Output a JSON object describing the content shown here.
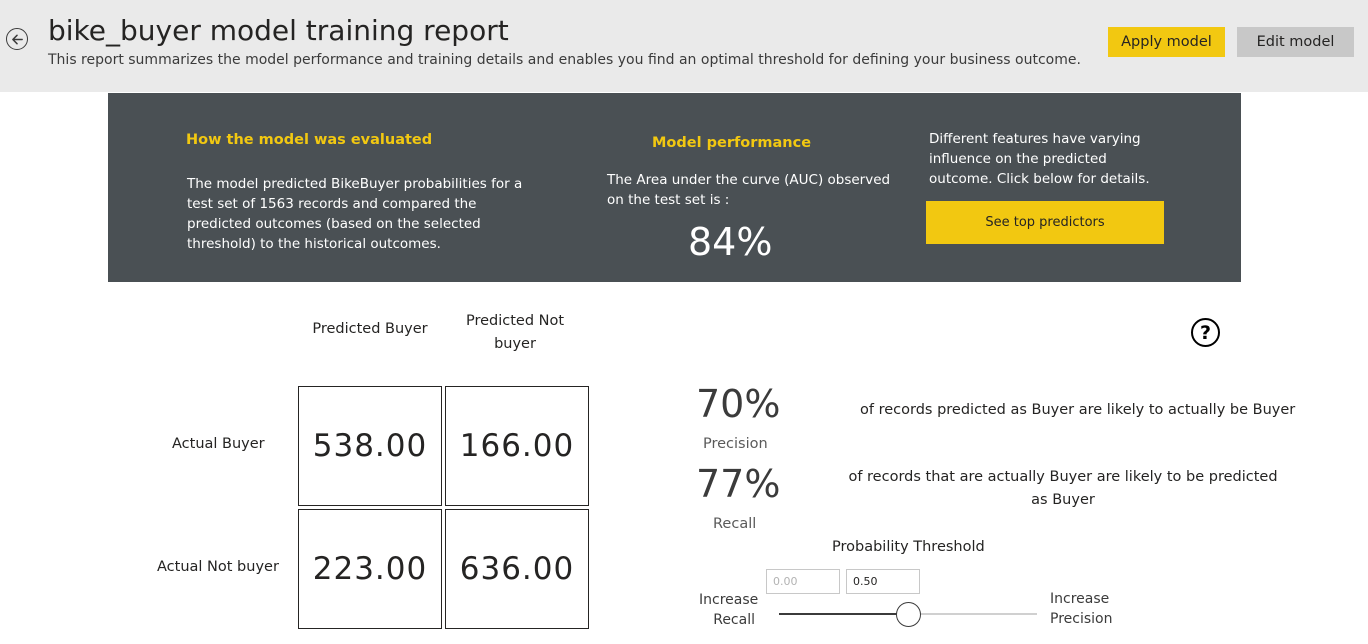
{
  "header": {
    "title": "bike_buyer model training report",
    "subtitle": "This report summarizes the model performance and training details and enables you find an optimal threshold for defining your business outcome.",
    "apply_label": "Apply model",
    "edit_label": "Edit model"
  },
  "panel": {
    "eval_heading": "How the model was evaluated",
    "eval_text": "The model predicted BikeBuyer probabilities for a test set of 1563 records and compared the predicted outcomes (based on the selected threshold) to the historical outcomes.",
    "perf_heading": "Model performance",
    "perf_text": "The Area under the curve (AUC) observed on the test set is :",
    "auc_value": "84%",
    "features_text": "Different features have varying influence on the predicted outcome.  Click below for details.",
    "top_predictors_label": "See top predictors"
  },
  "matrix": {
    "col_predicted_buyer": "Predicted Buyer",
    "col_predicted_not_buyer": "Predicted Not buyer",
    "row_actual_buyer": "Actual Buyer",
    "row_actual_not_buyer": "Actual Not buyer",
    "tp": "538.00",
    "fn": "166.00",
    "fp": "223.00",
    "tn": "636.00"
  },
  "metrics": {
    "precision_value": "70%",
    "precision_label": "Precision",
    "precision_desc": "of records predicted as Buyer are likely to actually be Buyer",
    "recall_value": "77%",
    "recall_label": "Recall",
    "recall_desc": "of records that are actually Buyer are likely to be predicted as Buyer"
  },
  "threshold": {
    "title": "Probability Threshold",
    "min_value": "0.00",
    "current_value": "0.50",
    "left_label_line1": "Increase",
    "left_label_line2": "Recall",
    "right_label_line1": "Increase",
    "right_label_line2": "Precision",
    "slider_fraction": 0.5
  },
  "colors": {
    "accent": "#f2c811",
    "panel_bg": "#4a5054",
    "header_bg": "#eaeaea"
  },
  "icons": {
    "back": "back-arrow-icon",
    "help": "help-icon"
  }
}
